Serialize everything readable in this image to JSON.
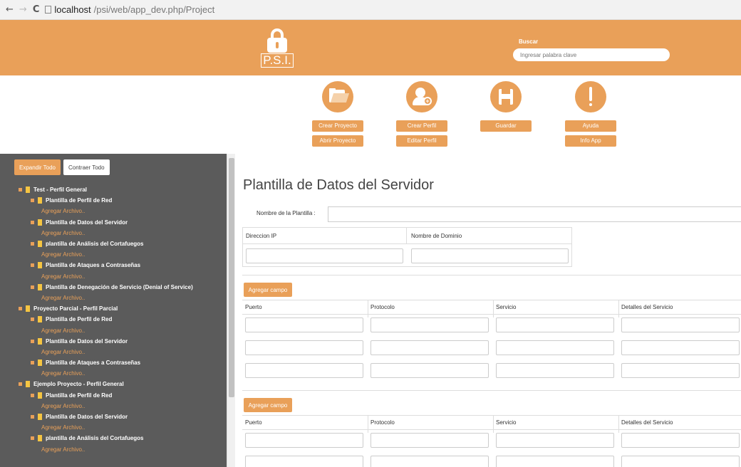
{
  "browser": {
    "back": "←",
    "forward": "→",
    "reload": "C",
    "url_host": "localhost",
    "url_path": "/psi/web/app_dev.php/Project"
  },
  "header": {
    "logo_text": "P.S.I.",
    "search_label": "Buscar",
    "search_placeholder": "Ingresar palabra clave"
  },
  "toolbar": {
    "project": {
      "icon": "folder-icon",
      "buttons": [
        "Crear Proyecto",
        "Abrir Proyecto"
      ]
    },
    "profile": {
      "icon": "add-user-icon",
      "buttons": [
        "Crear Perfil",
        "Editar Perfil"
      ]
    },
    "save": {
      "icon": "floppy-disk-icon",
      "buttons": [
        "Guardar"
      ]
    },
    "help": {
      "icon": "exclamation-icon",
      "buttons": [
        "Ayuda",
        "Info App"
      ]
    }
  },
  "sidebar": {
    "expand_all": "Expandir Todo",
    "collapse_all": "Contraer Todo",
    "add_file": "Agregar Archivo..",
    "tree": [
      {
        "level": 1,
        "label": "Test - Perfil General"
      },
      {
        "level": 2,
        "label": "Plantilla de Perfil de Red"
      },
      {
        "level": "add"
      },
      {
        "level": 2,
        "label": "Plantilla de Datos del Servidor"
      },
      {
        "level": "add"
      },
      {
        "level": 2,
        "label": "plantilla de Análisis del Cortafuegos"
      },
      {
        "level": "add"
      },
      {
        "level": 2,
        "label": "Plantilla de Ataques a Contraseñas"
      },
      {
        "level": "add"
      },
      {
        "level": 2,
        "label": "Plantilla de Denegación de Servicio (Denial of Service)"
      },
      {
        "level": "add"
      },
      {
        "level": 1,
        "label": "Proyecto Parcial - Perfil Parcial"
      },
      {
        "level": 2,
        "label": "Plantilla de Perfil de Red"
      },
      {
        "level": "add"
      },
      {
        "level": 2,
        "label": "Plantilla de Datos del Servidor"
      },
      {
        "level": "add"
      },
      {
        "level": 2,
        "label": "Plantilla de Ataques a Contraseñas"
      },
      {
        "level": "add"
      },
      {
        "level": 1,
        "label": "Ejemplo Proyecto - Perfil General"
      },
      {
        "level": 2,
        "label": "Plantilla de Perfil de Red"
      },
      {
        "level": "add"
      },
      {
        "level": 2,
        "label": "Plantilla de Datos del Servidor"
      },
      {
        "level": "add"
      },
      {
        "level": 2,
        "label": "plantilla de Análisis del Cortafuegos"
      },
      {
        "level": "add"
      }
    ]
  },
  "main": {
    "title": "Plantilla de Datos del Servidor",
    "template_name_label": "Nombre de la Plantilla :",
    "template_name_value": "",
    "ip_label": "Direccion IP",
    "domain_label": "Nombre de Dominio",
    "add_field": "Agregar campo",
    "service_columns": [
      "Puerto",
      "Protocolo",
      "Servicio",
      "Detalles del Servicio"
    ]
  }
}
